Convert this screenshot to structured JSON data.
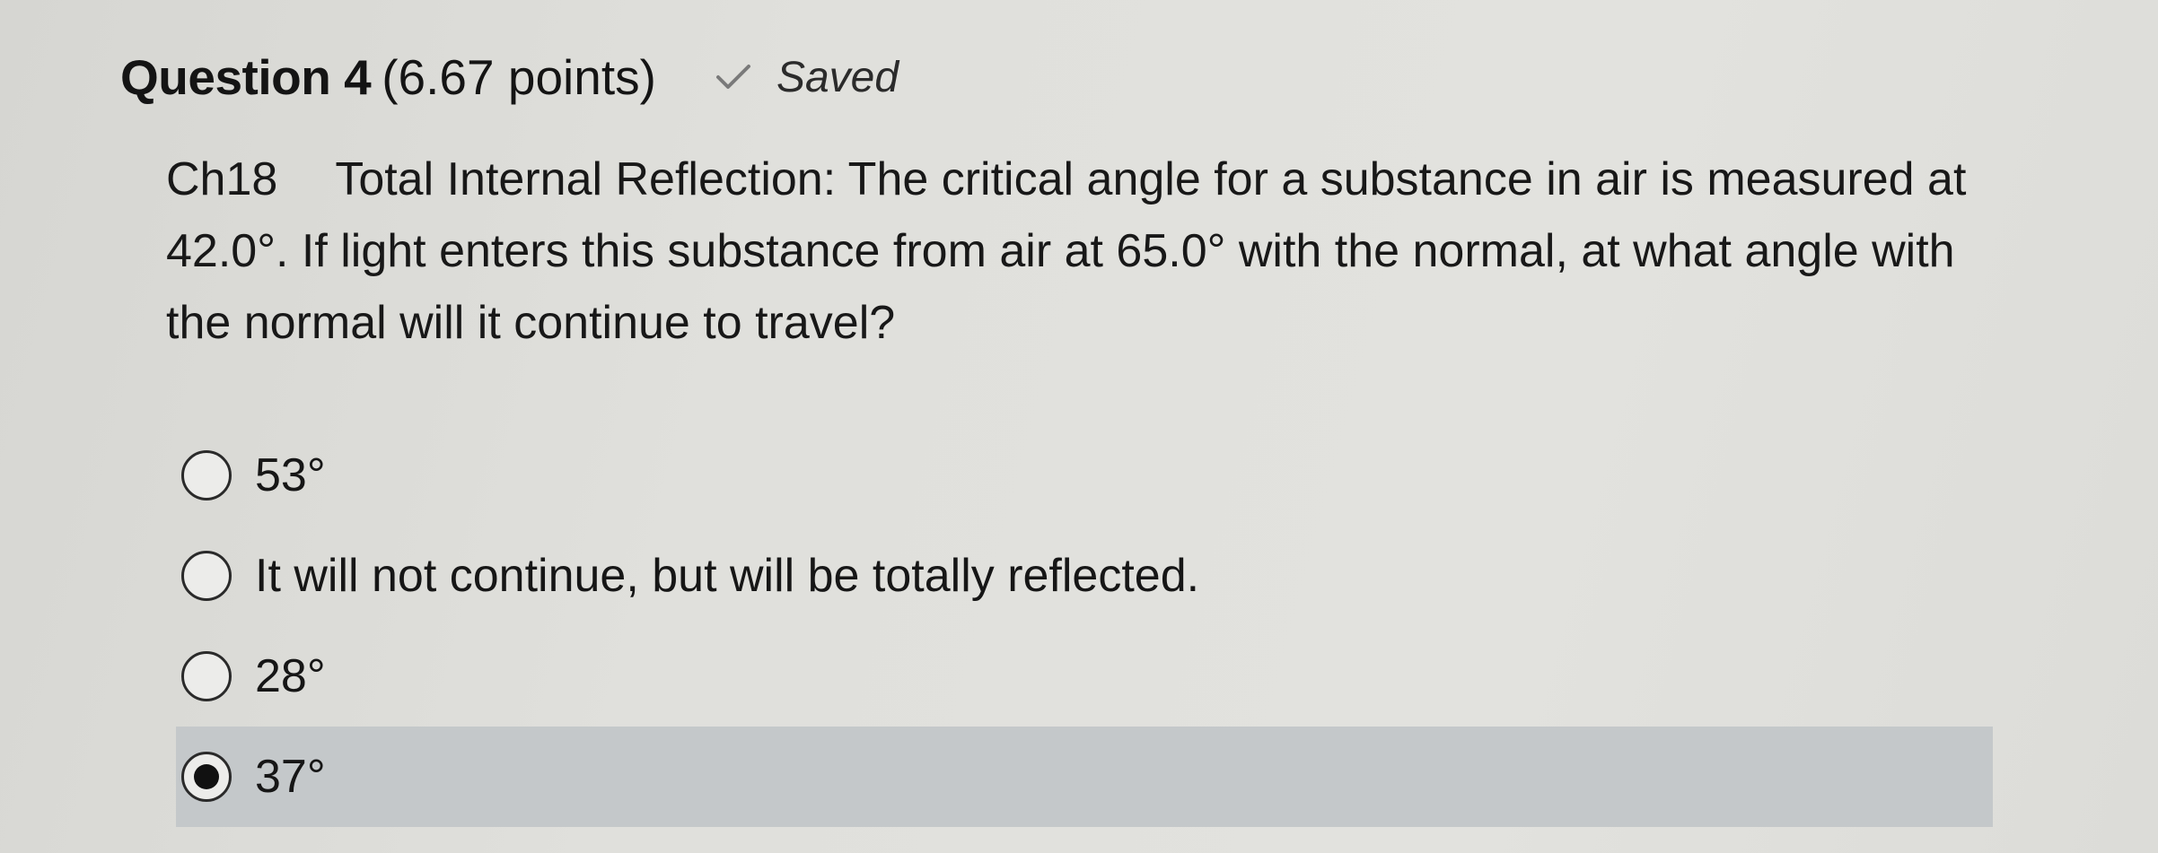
{
  "header": {
    "title": "Question 4",
    "points": "(6.67 points)",
    "status": "Saved",
    "status_icon": "check-icon"
  },
  "question": {
    "code": "Ch18",
    "text": "Total Internal Reflection: The critical angle for a substance in air is measured at 42.0°. If light enters this substance from air at 65.0° with the normal, at what angle with the normal will it continue to travel?"
  },
  "options": [
    {
      "label": "53°",
      "selected": false
    },
    {
      "label": "It will not continue, but will be totally reflected.",
      "selected": false
    },
    {
      "label": "28°",
      "selected": false
    },
    {
      "label": "37°",
      "selected": true
    }
  ],
  "colors": {
    "selected_background": "#c4c8ca",
    "page_background": "#e0e0dc"
  }
}
